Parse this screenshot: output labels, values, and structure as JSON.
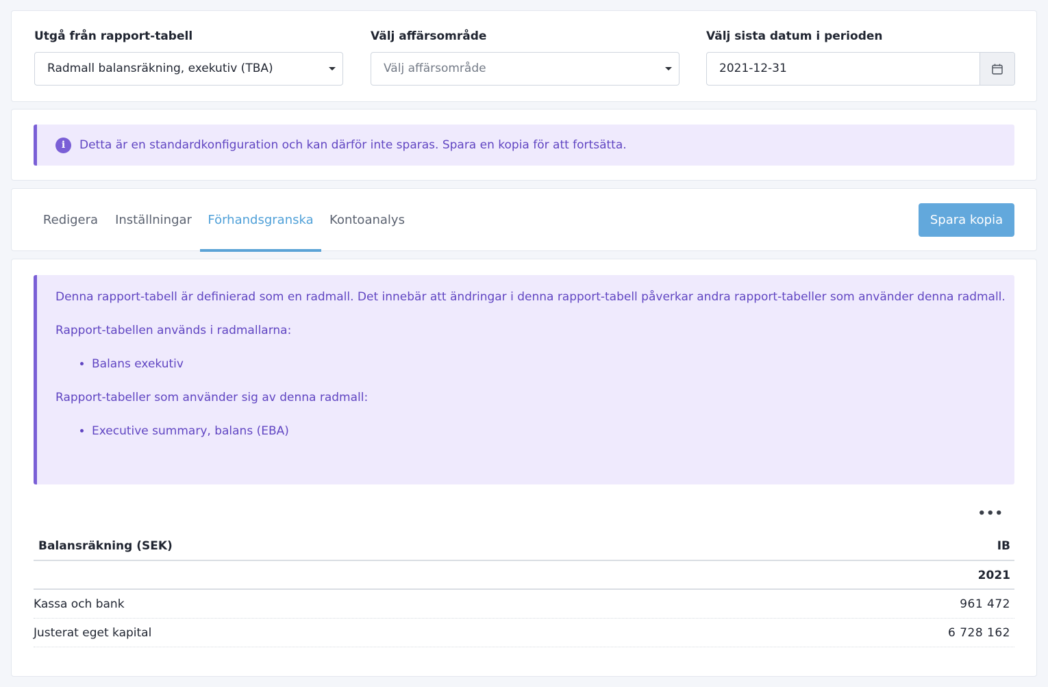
{
  "filters": {
    "report_table": {
      "label": "Utgå från rapport-tabell",
      "value": "Radmall balansräkning, exekutiv (TBA)"
    },
    "business_area": {
      "label": "Välj affärsområde",
      "placeholder": "Välj affärsområde"
    },
    "end_date": {
      "label": "Välj sista datum i perioden",
      "value": "2021-12-31"
    }
  },
  "notice": {
    "text": "Detta är en standardkonfiguration och kan därför inte sparas. Spara en kopia för att fortsätta."
  },
  "tabs": [
    {
      "label": "Redigera"
    },
    {
      "label": "Inställningar"
    },
    {
      "label": "Förhandsgranska"
    },
    {
      "label": "Kontoanalys"
    }
  ],
  "active_tab": "Förhandsgranska",
  "save_copy_label": "Spara kopia",
  "info": {
    "description": "Denna rapport-tabell är definierad som en radmall. Det innebär att ändringar i denna rapport-tabell påverkar andra rapport-tabeller som använder denna radmall.",
    "used_in_heading": "Rapport-tabellen används i radmallarna:",
    "used_in": [
      "Balans exekutiv"
    ],
    "users_heading": "Rapport-tabeller som använder sig av denna radmall:",
    "users": [
      "Executive summary, balans (EBA)"
    ]
  },
  "table": {
    "header": "Balansräkning (SEK)",
    "column": "IB",
    "year": "2021",
    "rows": [
      {
        "label": "Kassa och bank",
        "value": "961 472"
      },
      {
        "label": "Justerat eget kapital",
        "value": "6 728 162"
      }
    ]
  },
  "colors": {
    "accent": "#5ba3d6",
    "button": "#62a8dc",
    "notice_bg": "#efeafd",
    "notice_border": "#7a5fd6",
    "notice_text": "#6045c2"
  }
}
